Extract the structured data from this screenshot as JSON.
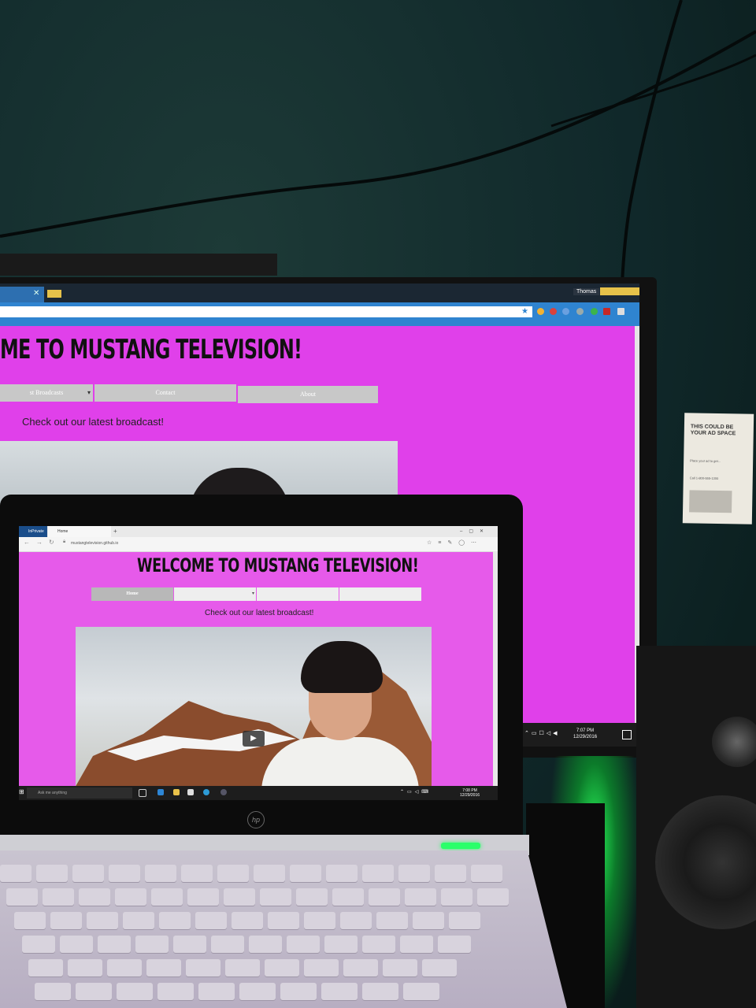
{
  "monitor": {
    "browser": {
      "user_label": "Thomas"
    },
    "site": {
      "title": "ME TO MUSTANG TELEVISION!",
      "nav": [
        "st Broadcasts",
        "Contact",
        "About"
      ],
      "subtitle": "Check out our latest broadcast!"
    },
    "taskbar": {
      "time": "7:07 PM",
      "date": "12/29/2016"
    }
  },
  "flyer": {
    "headline": "THIS COULD BE YOUR AD SPACE",
    "body": "Place your ad to get...",
    "phone": "Call 1-800-555-1300"
  },
  "laptop": {
    "browser": {
      "inprivate_label": "InPrivate",
      "tab_label": "Home",
      "url": "mustangtelevision.github.io"
    },
    "site": {
      "title": "WELCOME TO MUSTANG TELEVISION!",
      "nav": [
        "Home",
        "",
        "",
        ""
      ],
      "subtitle": "Check out our latest broadcast!"
    },
    "taskbar": {
      "search_placeholder": "Ask me anything",
      "time": "7:08 PM",
      "date": "12/29/2016"
    },
    "brand": "hp"
  },
  "colors": {
    "site_background_monitor": "#e040ea",
    "site_background_laptop": "#e65aea",
    "glow": "#2aff5b"
  }
}
